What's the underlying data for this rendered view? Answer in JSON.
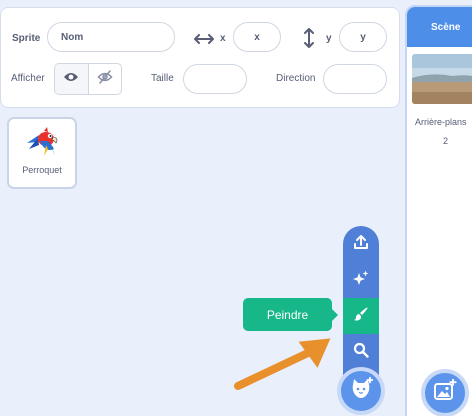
{
  "sprite_info": {
    "sprite_label": "Sprite",
    "name_placeholder": "Nom",
    "x_label": "x",
    "x_placeholder": "x",
    "y_label": "y",
    "y_placeholder": "y",
    "show_label": "Afficher",
    "size_label": "Taille",
    "direction_label": "Direction",
    "x_icon": "horizontal-arrows-icon",
    "y_icon": "vertical-arrows-icon",
    "show_icon": "eye-icon",
    "hide_icon": "eye-slash-icon"
  },
  "sprites": [
    {
      "name": "Perroquet",
      "icon": "parrot-icon"
    }
  ],
  "sprite_menu": {
    "items": [
      {
        "icon": "upload-icon"
      },
      {
        "icon": "surprise-sparkle-icon"
      },
      {
        "icon": "paint-brush-icon",
        "highlighted": true
      },
      {
        "icon": "search-icon"
      }
    ],
    "tooltip": "Peindre",
    "main_icon": "cat-plus-icon"
  },
  "stage": {
    "header": "Scène",
    "backdrops_label": "Arrière-plans",
    "backdrops_count": "2",
    "main_icon": "image-plus-icon"
  },
  "colors": {
    "accent_blue": "#4d8ee8",
    "menu_blue": "#4f7fd7",
    "highlight_green": "#18b78a",
    "arrow_orange": "#e8902c",
    "background": "#e9f0fb"
  }
}
